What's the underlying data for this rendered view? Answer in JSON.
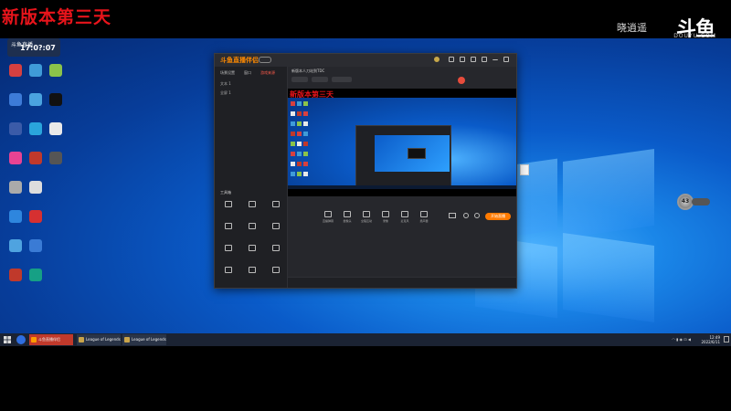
{
  "overlay": {
    "title": "新版本第三天"
  },
  "watermark": {
    "host": "晓逍遥",
    "logo": "斗鱼",
    "domain": "DOUYU.COM"
  },
  "left_widget": {
    "label": "斗鱼直播",
    "counter": "17:0?:07"
  },
  "desktop_icons": [
    {
      "label": "",
      "color": "#d64040"
    },
    {
      "label": "",
      "color": "#3f9bd8"
    },
    {
      "label": "",
      "color": "#8bc34a"
    },
    {
      "label": "",
      "color": "#3d7bd8"
    },
    {
      "label": "",
      "color": "#4aa3df"
    },
    {
      "label": "",
      "color": "#111"
    },
    {
      "label": "",
      "color": "#3b5ba8"
    },
    {
      "label": "",
      "color": "#2aa5dc"
    },
    {
      "label": "",
      "color": "#e9e9e9"
    },
    {
      "label": "",
      "color": "#e84393"
    },
    {
      "label": "",
      "color": "#c0392b"
    },
    {
      "label": "",
      "color": "#555"
    },
    {
      "label": "",
      "color": "#aaa"
    },
    {
      "label": "",
      "color": "#ddd"
    },
    {
      "label": "",
      "color": "#2a6dd4"
    },
    {
      "label": "",
      "color": "#2e86de"
    },
    {
      "label": "",
      "color": "#d63031"
    },
    {
      "label": "",
      "color": "#bbb"
    },
    {
      "label": "",
      "color": "#4fa3e0"
    },
    {
      "label": "",
      "color": "#3a7bd5"
    },
    {
      "label": "",
      "color": "#ddd"
    },
    {
      "label": "",
      "color": "#c0392b"
    },
    {
      "label": "",
      "color": "#16a085"
    },
    {
      "label": "",
      "color": "#1abc9c"
    }
  ],
  "app": {
    "brand": "斗鱼直播伴侣",
    "brand_pill": "",
    "side_tabs": [
      "场景设置",
      "窗口",
      "游戏来源"
    ],
    "side_rows": [
      "文本 1",
      "全屏 1"
    ],
    "tools_label": "工具箱",
    "tools": [
      "",
      "",
      "",
      "",
      "",
      "",
      "",
      "",
      "",
      "",
      "",
      ""
    ],
    "room_title": "新版本人刀站到TDC",
    "controls": [
      "直播弹幕",
      "摄像头",
      "全程互动",
      "录像",
      "麦克风",
      "扬声器"
    ],
    "live_label": "开始直播",
    "status": ""
  },
  "preview": {
    "overlay_text": "新版本第三天"
  },
  "float_badge": {
    "value": "43"
  },
  "file_icon": {
    "label": ""
  },
  "taskbar": {
    "items": [
      "斗鱼直播伴侣",
      "League of Legends",
      "League of Legends"
    ],
    "clock_time": "12:49",
    "clock_date": "2022/6/11"
  }
}
